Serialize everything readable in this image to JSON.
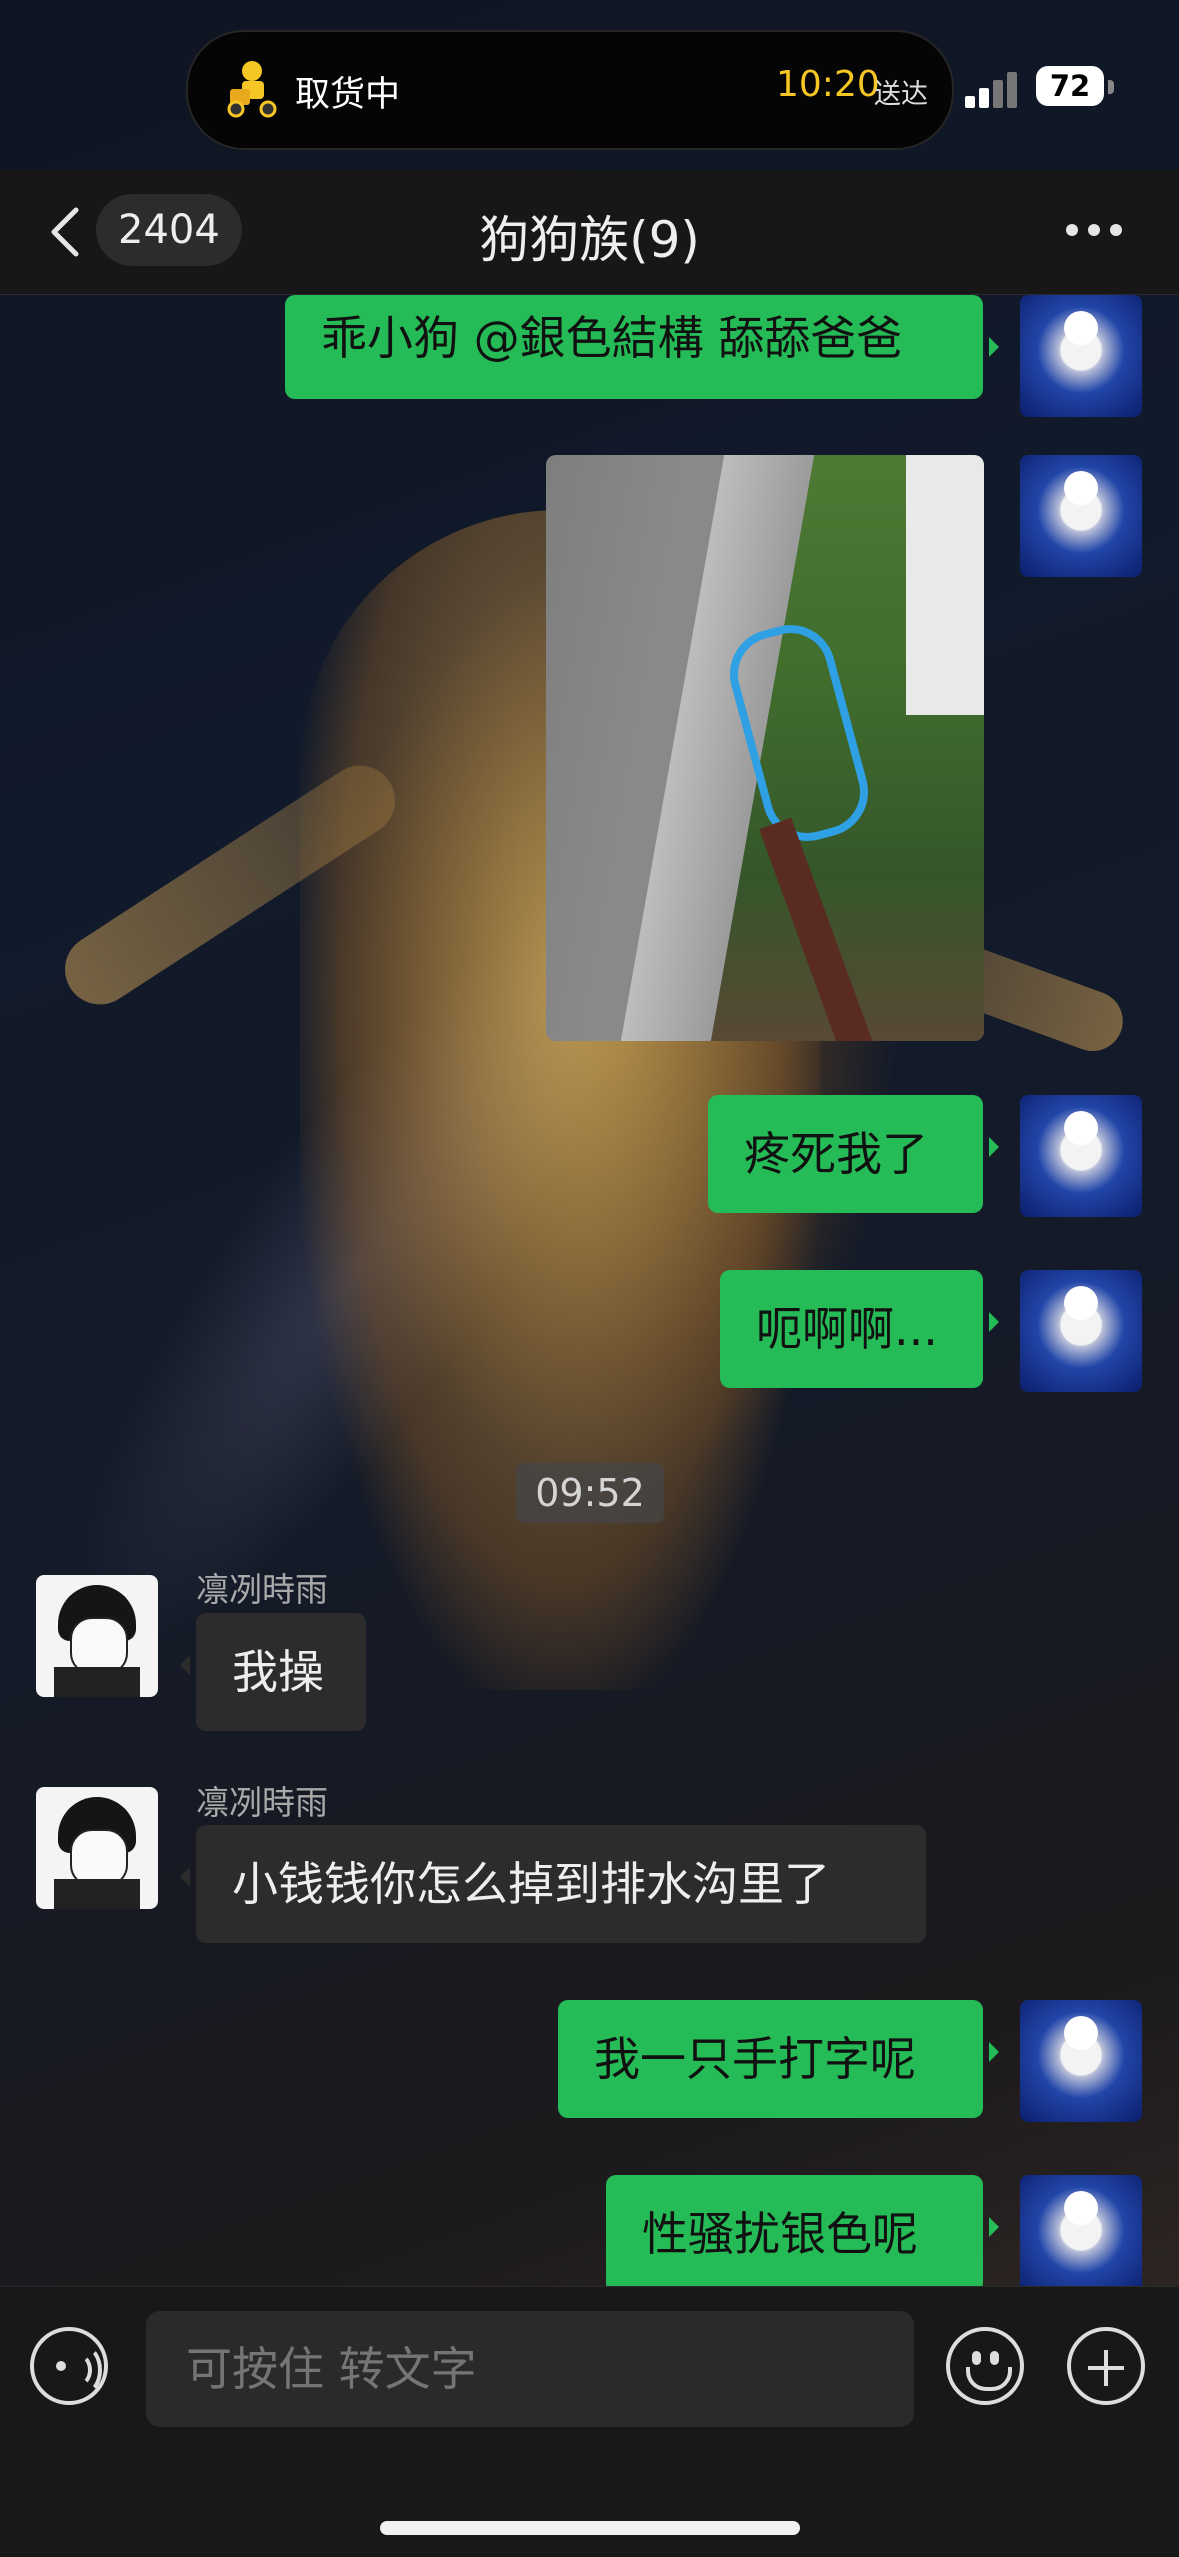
{
  "status": {
    "activity_label": "取货中",
    "delivery_time": "10:20",
    "delivery_label": "送达",
    "battery": "72",
    "signal_bars": 2
  },
  "nav": {
    "unread_count": "2404",
    "title": "狗狗族(9)"
  },
  "messages": [
    {
      "id": "m1",
      "from": "me",
      "type": "text",
      "text": "乖小狗 @銀色結構 舔舔爸爸"
    },
    {
      "id": "m2",
      "from": "me",
      "type": "image",
      "image_desc": "bike-in-ditch-photo"
    },
    {
      "id": "m3",
      "from": "me",
      "type": "text",
      "text": "疼死我了"
    },
    {
      "id": "m4",
      "from": "me",
      "type": "text",
      "text": "呃啊啊..."
    },
    {
      "id": "t1",
      "type": "time",
      "text": "09:52"
    },
    {
      "id": "m5",
      "from": "other",
      "sender": "凛冽時雨",
      "type": "text",
      "text": "我操"
    },
    {
      "id": "m6",
      "from": "other",
      "sender": "凛冽時雨",
      "type": "text",
      "text": "小钱钱你怎么掉到排水沟里了"
    },
    {
      "id": "m7",
      "from": "me",
      "type": "text",
      "text": "我一只手打字呢"
    },
    {
      "id": "m8",
      "from": "me",
      "type": "text",
      "text": "性骚扰银色呢"
    }
  ],
  "input": {
    "placeholder": "可按住 转文字"
  },
  "colors": {
    "bubble_me": "#25bc57",
    "bubble_other": "#2c2c2c",
    "delivery_time": "#f6c624"
  },
  "icons": [
    "delivery-rider-icon",
    "signal-icon",
    "battery-icon",
    "back-icon",
    "more-icon",
    "voice-icon",
    "emoji-icon",
    "plus-icon"
  ]
}
